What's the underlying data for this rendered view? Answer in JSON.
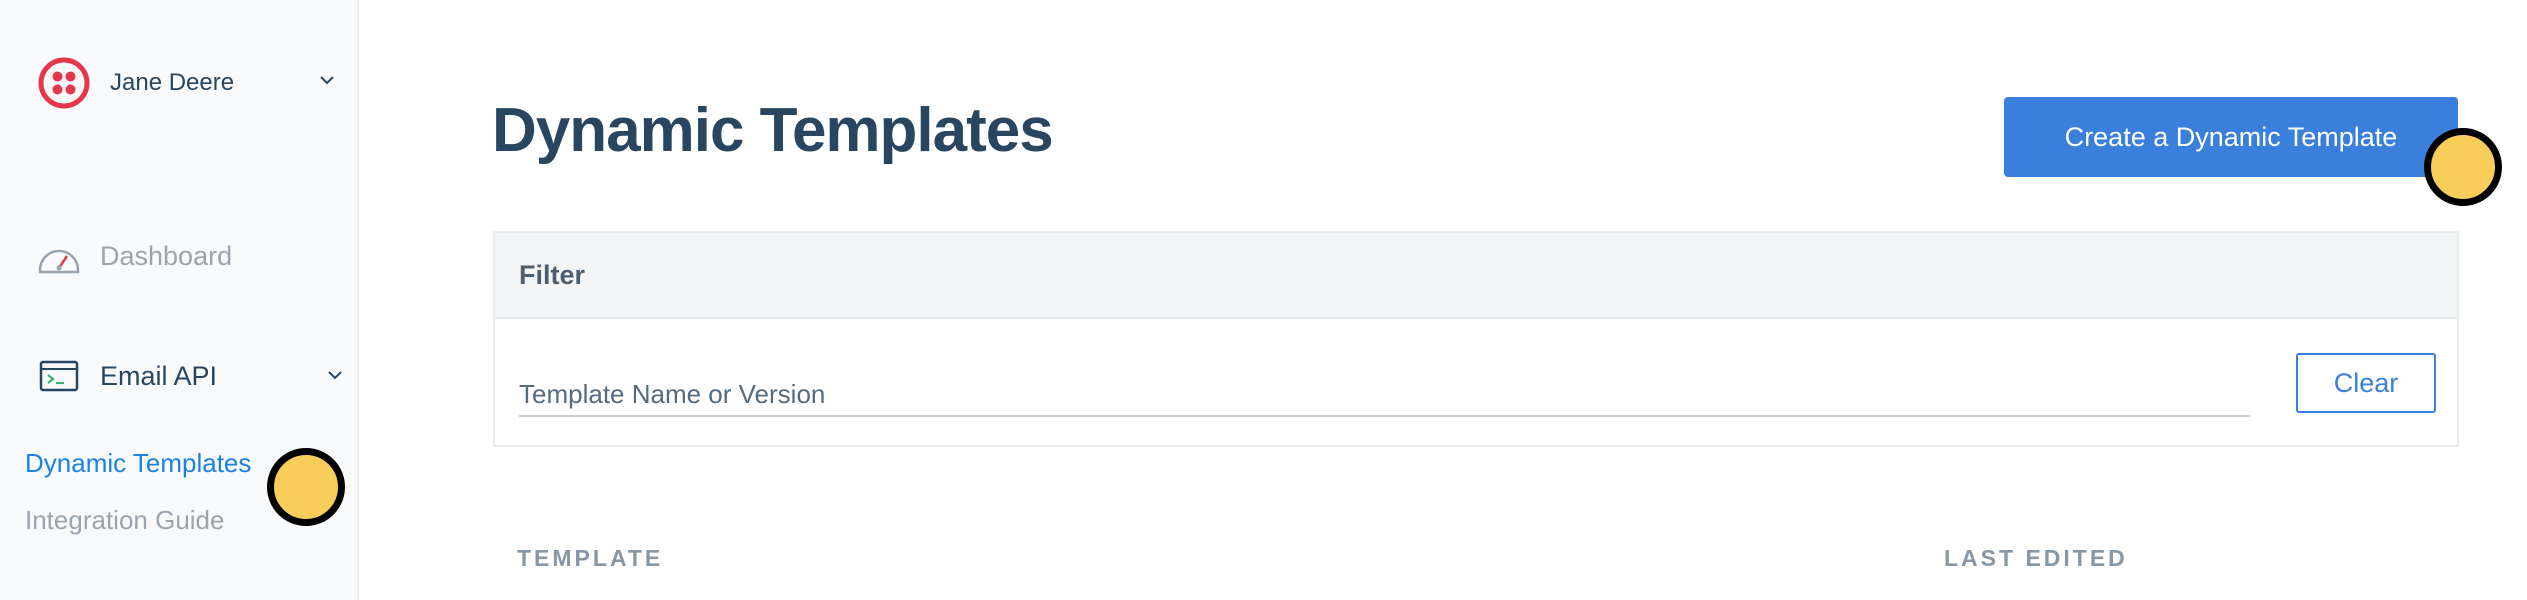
{
  "sidebar": {
    "account_name": "Jane Deere",
    "nav": [
      {
        "label": "Dashboard",
        "icon": "dashboard-gauge-icon"
      },
      {
        "label": "Email API",
        "icon": "terminal-icon"
      }
    ],
    "sub_items": [
      {
        "label": "Dynamic Templates",
        "active": true
      },
      {
        "label": "Integration Guide",
        "active": false
      }
    ]
  },
  "main": {
    "title": "Dynamic Templates",
    "create_button": "Create a Dynamic Template",
    "filter": {
      "title": "Filter",
      "placeholder": "Template Name or Version",
      "value": "",
      "clear_label": "Clear"
    },
    "columns": [
      "TEMPLATE",
      "LAST EDITED"
    ]
  },
  "colors": {
    "accent": "#3a7fdb",
    "brand_red": "#e5364b",
    "title": "#294661",
    "marker": "#f8cd5a"
  }
}
